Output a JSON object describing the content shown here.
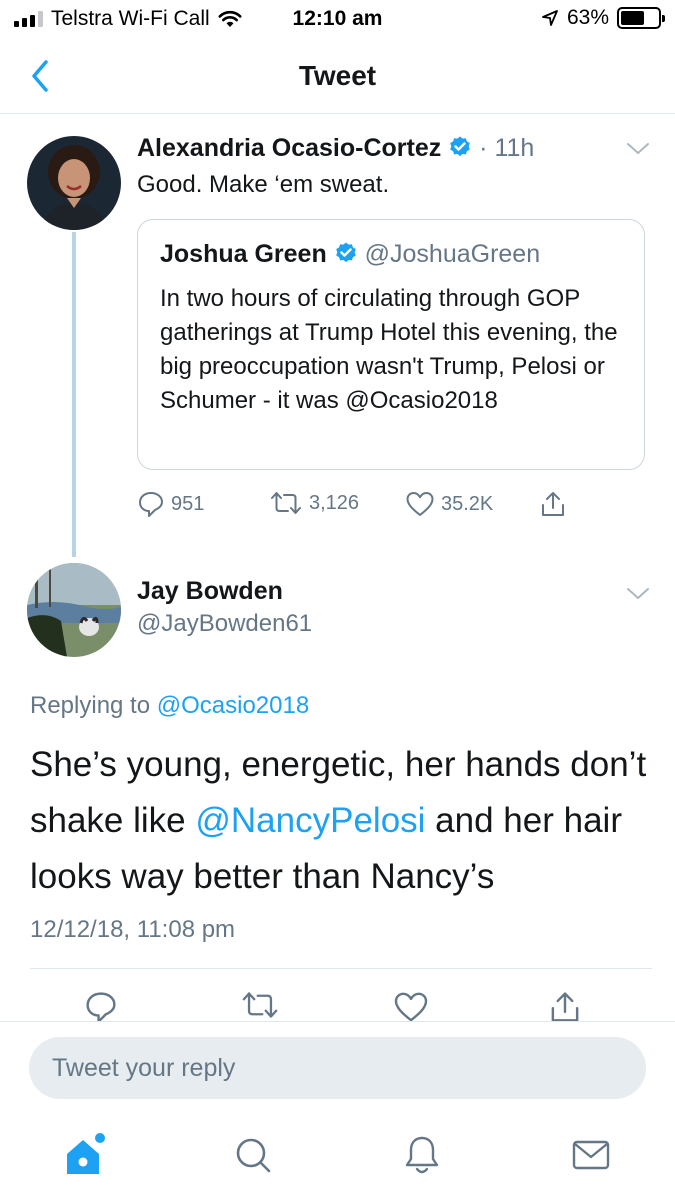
{
  "status_bar": {
    "carrier": "Telstra Wi-Fi Call",
    "time": "12:10 am",
    "battery_percent": "63%",
    "battery_level": 0.63,
    "icons": [
      "signal-icon",
      "wifi-icon",
      "location-arrow-icon",
      "battery-icon"
    ]
  },
  "header": {
    "title": "Tweet",
    "back_icon": "chevron-left-icon"
  },
  "tweet1": {
    "author_name": "Alexandria Ocasio-Cortez",
    "time_separator": "·",
    "time": "11h",
    "text": "Good. Make ‘em sweat.",
    "quote": {
      "author_name": "Joshua Green",
      "author_handle": "@JoshuaGreen",
      "text": "In two hours of circulating through GOP gatherings at Trump Hotel this evening, the big preoccupation wasn't Trump, Pelosi or Schumer - it was @Ocasio2018"
    },
    "actions": {
      "reply_count": "951",
      "retweet_count": "3,126",
      "like_count": "35.2K"
    }
  },
  "tweet2": {
    "author_name": "Jay Bowden",
    "author_handle": "@JayBowden61",
    "replying_prefix": "Replying to",
    "replying_handle": "@Ocasio2018",
    "text_part1": "She’s young, energetic, her hands don’t shake like ",
    "mention": "@NancyPelosi",
    "text_part2": " and her hair looks way better than Nancy’s",
    "timestamp": "12/12/18, 11:08 pm"
  },
  "composer": {
    "placeholder": "Tweet your reply"
  },
  "tabbar": {
    "items": [
      "home-icon",
      "search-icon",
      "notifications-icon",
      "messages-icon"
    ],
    "active": "home-icon"
  },
  "colors": {
    "accent": "#1da1f2",
    "muted": "#657786",
    "text": "#14171a",
    "thread_line": "#b8d3e6",
    "composer_bg": "#e6ecf0"
  }
}
